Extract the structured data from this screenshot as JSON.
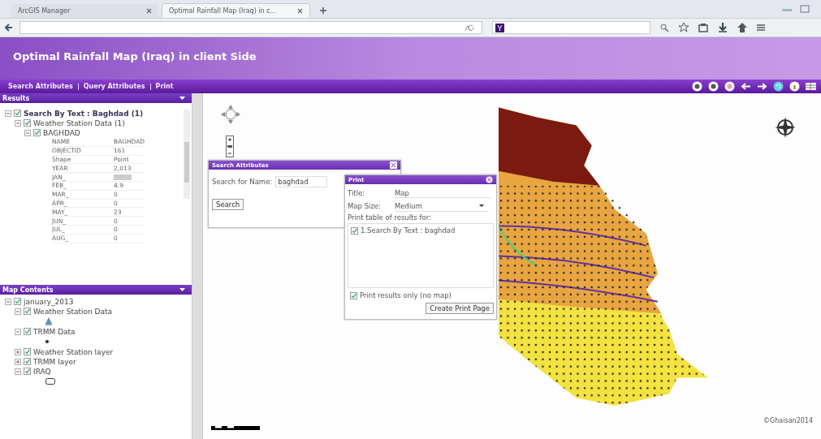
{
  "browser": {
    "tabs": [
      {
        "label": "ArcGIS Manager",
        "selected": false
      },
      {
        "label": "Optimal Rainfall Map (Iraq) in c...",
        "selected": true
      }
    ]
  },
  "app": {
    "title": "Optimal Rainfall Map (Iraq) in client Side",
    "menu": [
      "Search Attributes",
      "Query Attributes",
      "Print"
    ]
  },
  "results": {
    "title": "Results",
    "tree": [
      {
        "label": "Search By Text : Baghdad (1)",
        "bold": true,
        "checked": true,
        "expanded": true,
        "children": [
          {
            "label": "Weather Station Data (1)",
            "checked": true,
            "expanded": true,
            "children": [
              {
                "label": "BAGHDAD",
                "checked": true,
                "expanded": true,
                "attributes": [
                  {
                    "name": "NAME",
                    "value": "BAGHDAD"
                  },
                  {
                    "name": "OBJECTID",
                    "value": "161"
                  },
                  {
                    "name": "Shape",
                    "value": "Point"
                  },
                  {
                    "name": "YEAR",
                    "value": "2,013"
                  },
                  {
                    "name": "JAN_",
                    "highlighted": true
                  },
                  {
                    "name": "FEB_",
                    "value": "4.9"
                  },
                  {
                    "name": "MAR_",
                    "value": "0"
                  },
                  {
                    "name": "APR_",
                    "value": "0"
                  },
                  {
                    "name": "MAY_",
                    "value": "23"
                  },
                  {
                    "name": "JUN_",
                    "value": "0"
                  },
                  {
                    "name": "JUL_",
                    "value": "0"
                  },
                  {
                    "name": "AUG_",
                    "value": "0"
                  }
                ]
              }
            ]
          }
        ]
      }
    ]
  },
  "map_contents": {
    "title": "Map Contents",
    "tree": [
      {
        "label": "january_2013",
        "checked": true,
        "expanded": true,
        "children": [
          {
            "label": "Weather Station Data",
            "checked": true,
            "expanded": true,
            "kind": "marker"
          },
          {
            "label": "TRMM Data",
            "checked": true,
            "expanded": true,
            "kind": "dot"
          },
          {
            "label": "Weather Station layer",
            "checked": true,
            "expanded": false
          },
          {
            "label": "TRMM layer",
            "checked": true,
            "expanded": false
          },
          {
            "label": "IRAQ",
            "checked": true,
            "expanded": true,
            "kind": "rect"
          }
        ]
      }
    ]
  },
  "search_window": {
    "title": "Search Attributes",
    "label": "Search for Name:",
    "value": "baghdad",
    "button": "Search"
  },
  "print_window": {
    "title": "Print",
    "title_label": "Title:",
    "title_value": "Map",
    "size_label": "Map Size:",
    "size_value": "Medium",
    "table_label": "Print table of results for:",
    "results": [
      {
        "label": "1.Search By Text : baghdad",
        "checked": true
      }
    ],
    "results_only": {
      "label": "Print results only (no map)",
      "checked": true
    },
    "button": "Create Print Page"
  },
  "map": {
    "credit": "©Ghaisan2014"
  }
}
